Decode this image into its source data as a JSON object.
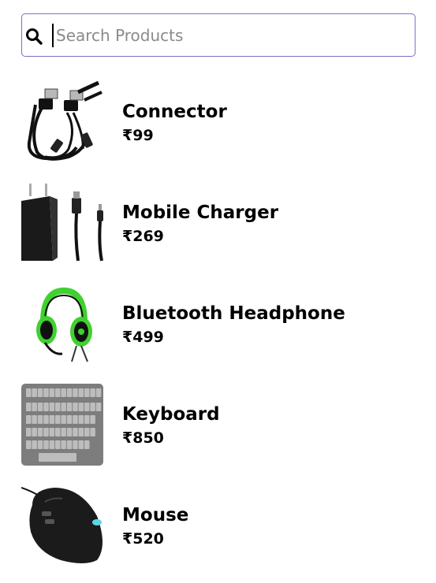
{
  "search": {
    "placeholder": "Search Products",
    "value": ""
  },
  "products": [
    {
      "name": "Connector",
      "price": "₹99"
    },
    {
      "name": "Mobile Charger",
      "price": "₹269"
    },
    {
      "name": "Bluetooth Headphone",
      "price": "₹499"
    },
    {
      "name": "Keyboard",
      "price": "₹850"
    },
    {
      "name": "Mouse",
      "price": "₹520"
    }
  ],
  "colors": {
    "search_border": "#7b6fc9",
    "placeholder": "#8a8a8a",
    "headphone_accent": "#3fd12f"
  },
  "icons": [
    "search-icon",
    "usb-cable-image",
    "charger-image",
    "headphone-image",
    "keyboard-image",
    "mouse-image"
  ]
}
